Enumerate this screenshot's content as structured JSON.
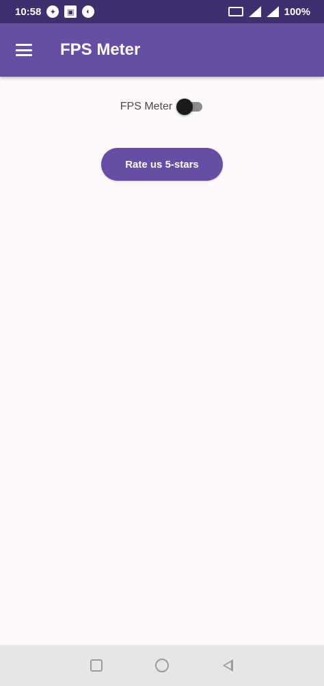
{
  "status_bar": {
    "time": "10:58",
    "battery": "100%",
    "icons_left": [
      "app-notification-icon",
      "image-notification-icon",
      "cast-notification-icon"
    ],
    "icons_right": [
      "nfc-icon",
      "wifi-signal-icon",
      "cell-signal-icon"
    ]
  },
  "app_bar": {
    "title": "FPS Meter",
    "menu_icon": "hamburger-menu-icon",
    "color": "#654ea3"
  },
  "content": {
    "switch_label": "FPS Meter",
    "switch_on": false,
    "rate_button_label": "Rate us 5-stars"
  },
  "nav_bar": {
    "buttons": [
      "recents-icon",
      "home-icon",
      "back-icon"
    ]
  },
  "colors": {
    "status_bar": "#3f2f6f",
    "primary": "#654ea3",
    "background": "#fdf8fb",
    "nav_bar": "#e6e6e6"
  }
}
